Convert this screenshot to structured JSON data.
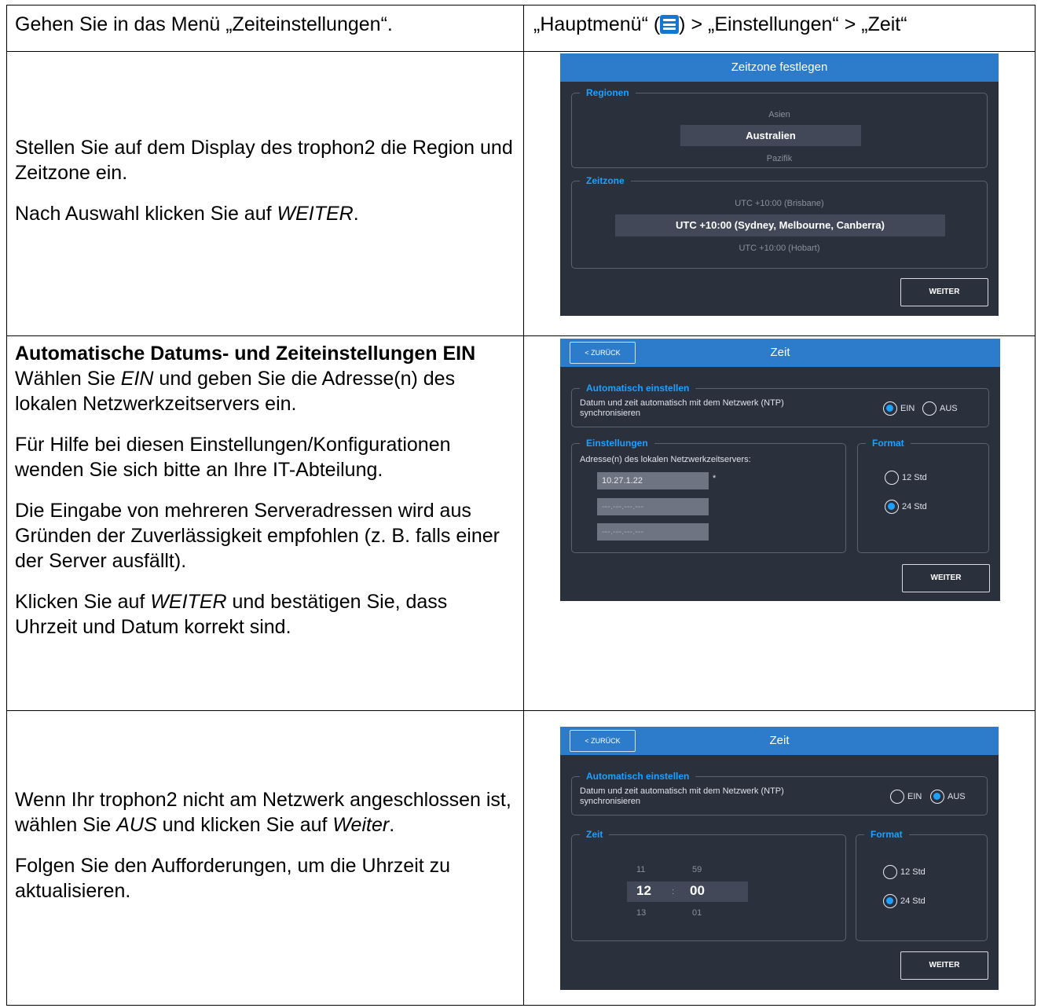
{
  "doc": {
    "row1": {
      "left": "Gehen Sie in das Menü „Zeiteinstellungen“.",
      "right_part1": "„Hauptmenü“ (",
      "right_icon": "menu-icon",
      "right_part2": ") > „Einstellungen“ > „Zeit“"
    },
    "row2": {
      "para1": "Stellen Sie auf dem Display des trophon2 die Region und Zeitzone ein.",
      "para2_prefix": "Nach Auswahl klicken Sie auf ",
      "para2_em": "WEITER",
      "para2_suffix": "."
    },
    "row3": {
      "heading": "Automatische Datums- und Zeiteinstellungen EIN",
      "para1_prefix": "Wählen Sie ",
      "para1_em": "EIN",
      "para1_suffix": " und geben Sie die Adresse(n) des lokalen Netzwerkzeitservers ein.",
      "para2": "Für Hilfe bei diesen Einstellungen/Konfigurationen wenden Sie sich bitte an Ihre IT-Abteilung.",
      "para3": "Die Eingabe von mehreren Serveradressen wird aus Gründen der Zuverlässigkeit empfohlen (z. B. falls einer der Server ausfällt).",
      "para4_prefix": "Klicken Sie auf ",
      "para4_em": "WEITER",
      "para4_suffix": " und bestätigen Sie, dass Uhrzeit und Datum korrekt sind."
    },
    "row4": {
      "para1_prefix": "Wenn Ihr trophon2 nicht am Netzwerk angeschlossen ist, wählen Sie ",
      "para1_em1": "AUS",
      "para1_mid": " und klicken Sie auf ",
      "para1_em2": "Weiter",
      "para1_suffix": ".",
      "para2": "Folgen Sie den Aufforderungen, um die Uhrzeit zu aktualisieren."
    }
  },
  "screen_timezone": {
    "title": "Zeitzone festlegen",
    "regions_legend": "Regionen",
    "region_prev": "Asien",
    "region_selected": "Australien",
    "region_next": "Pazifik",
    "zone_legend": "Zeitzone",
    "zone_prev": "UTC +10:00 (Brisbane)",
    "zone_selected": "UTC +10:00 (Sydney, Melbourne, Canberra)",
    "zone_next": "UTC +10:00 (Hobart)",
    "next_button": "WEITER"
  },
  "screen_time_on": {
    "back": "< ZURÜCK",
    "title": "Zeit",
    "auto_legend": "Automatisch einstellen",
    "auto_text": "Datum und zeit automatisch mit dem Netzwerk (NTP) synchronisieren",
    "on_label": "EIN",
    "off_label": "AUS",
    "auto_state": "EIN",
    "settings_legend": "Einstellungen",
    "servers_label": "Adresse(n) des lokalen Netzwerkzeitservers:",
    "server1": "10.27.1.22",
    "required_mark": "*",
    "server2_placeholder": "---.---.---.---",
    "server3_placeholder": "---.---.---.---",
    "format_legend": "Format",
    "format_12": "12 Std",
    "format_24": "24 Std",
    "format_state": "24 Std",
    "next_button": "WEITER"
  },
  "screen_time_off": {
    "back": "< ZURÜCK",
    "title": "Zeit",
    "auto_legend": "Automatisch einstellen",
    "auto_text": "Datum und zeit automatisch mit dem Netzwerk (NTP) synchronisieren",
    "on_label": "EIN",
    "off_label": "AUS",
    "auto_state": "AUS",
    "time_legend": "Zeit",
    "hour_prev": "11",
    "minute_prev": "59",
    "hour": "12",
    "separator": ":",
    "minute": "00",
    "hour_next": "13",
    "minute_next": "01",
    "format_legend": "Format",
    "format_12": "12 Std",
    "format_24": "24 Std",
    "format_state": "24 Std",
    "next_button": "WEITER"
  },
  "colors": {
    "header_blue": "#2d7ccb",
    "screen_bg": "#2b303d",
    "accent": "#1ea0ff",
    "menu_icon": "#1677d2"
  }
}
